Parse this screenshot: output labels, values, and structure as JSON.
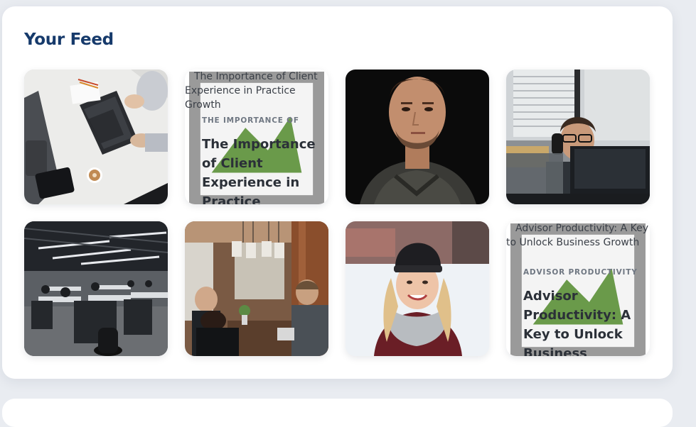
{
  "feed": {
    "title": "Your Feed",
    "cards": [
      {
        "type": "image",
        "subject": "overhead view of a person typing on a laptop at a white desk with coffee"
      },
      {
        "type": "article",
        "image_alt": "The Importance of Client Experience in Practice Growth",
        "kicker": "THE IMPORTANCE OF",
        "title": "The Importance of Client Experience in Practice Growth"
      },
      {
        "type": "image",
        "subject": "portrait of a bearded man in a knit sweater on black background"
      },
      {
        "type": "image",
        "subject": "smiling man with glasses on a phone call behind monitors"
      },
      {
        "type": "image",
        "subject": "large open-plan office with rows of people at desks"
      },
      {
        "type": "image",
        "subject": "people working at a shared table under pendant lights"
      },
      {
        "type": "image",
        "subject": "smiling woman in a black beanie and scarf in snow"
      },
      {
        "type": "article",
        "image_alt": "Advisor Productivity: A Key to Unlock Business Growth",
        "kicker": "ADVISOR PRODUCTIVITY",
        "title": "Advisor Productivity: A Key to Unlock Business Growth"
      }
    ]
  }
}
